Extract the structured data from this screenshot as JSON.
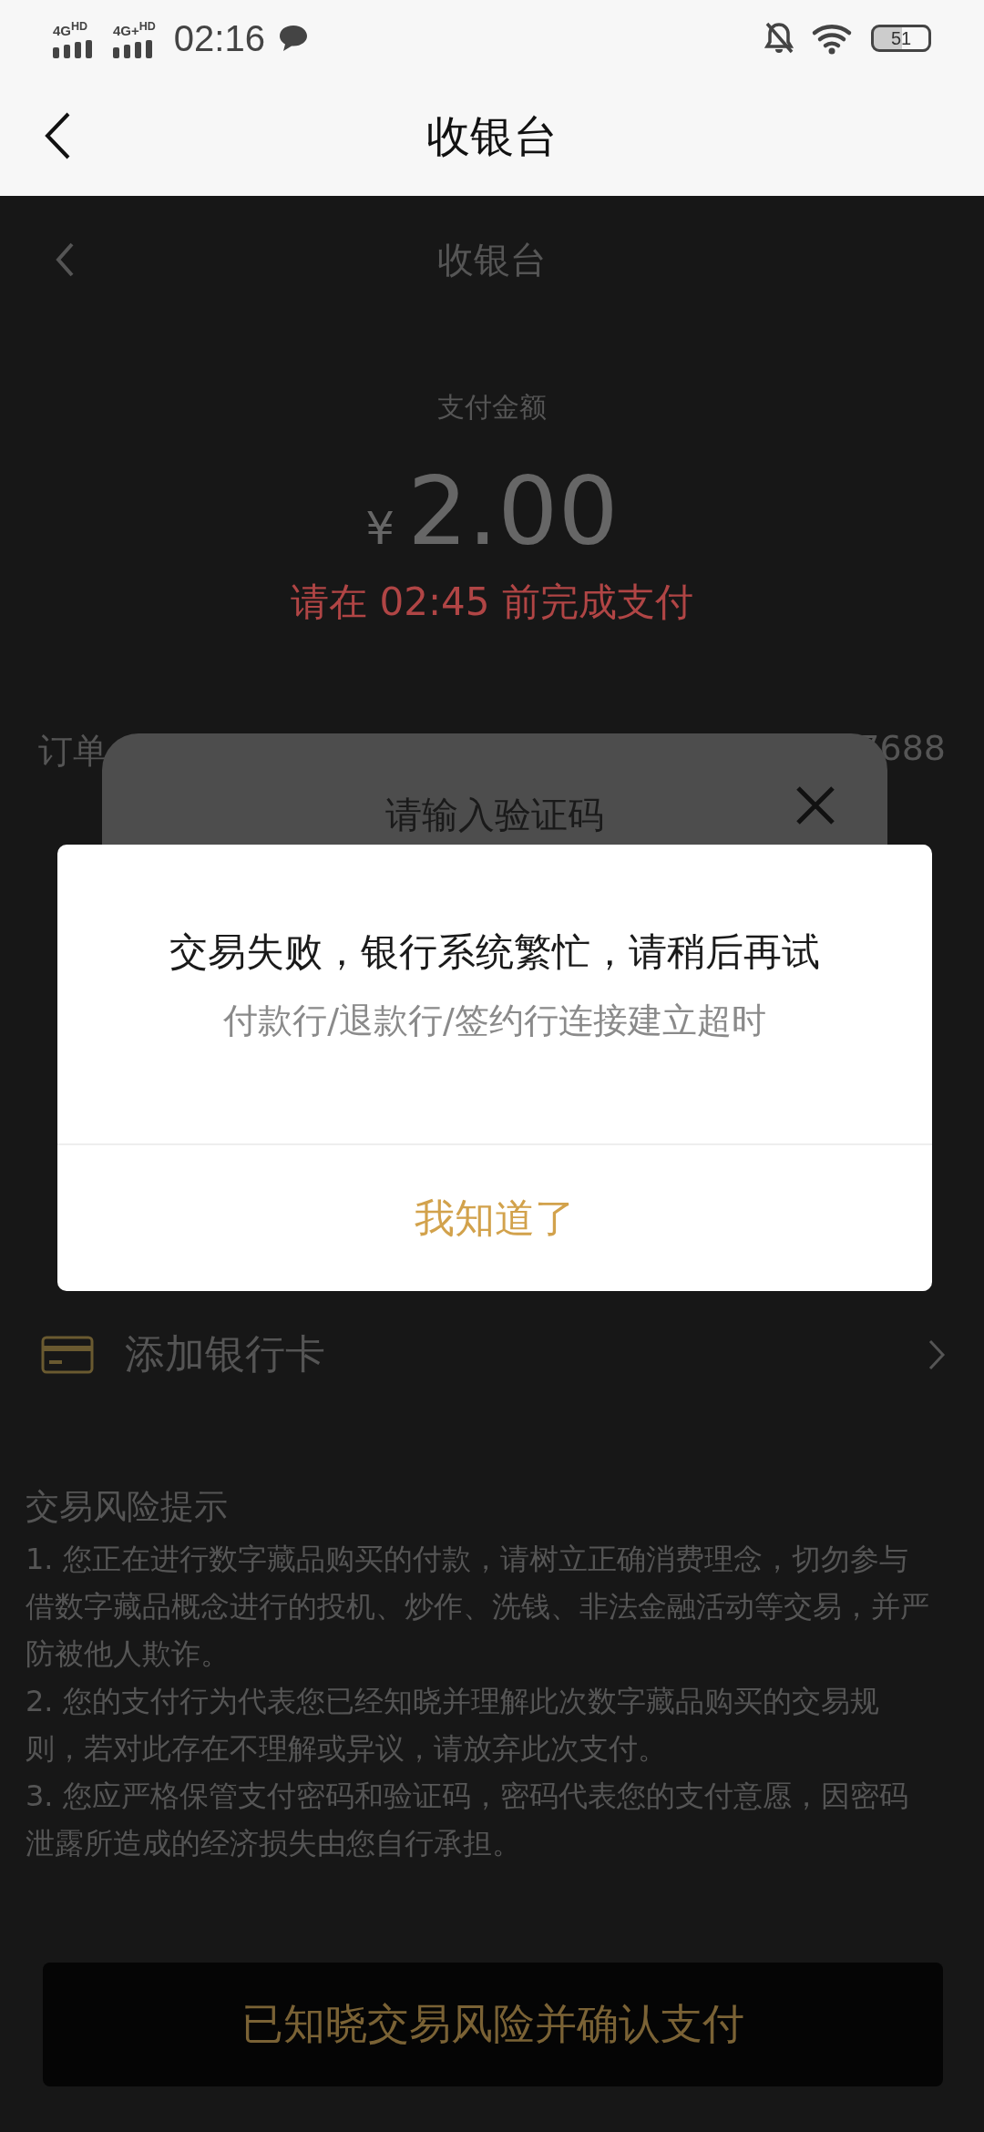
{
  "status_bar": {
    "networks": [
      "4G$^{HD}$",
      "4G+$^{HD}$"
    ],
    "time": "02:16",
    "battery": "51"
  },
  "header": {
    "title": "收银台"
  },
  "page": {
    "title": "收银台",
    "amount_label": "支付金额",
    "currency": "¥",
    "amount": "2.00",
    "deadline": "请在 02:45 前完成支付",
    "order_row": {
      "label": "订单",
      "value": "7688"
    },
    "add_card": {
      "label": "添加银行卡"
    },
    "risk": {
      "title": "交易风险提示",
      "items": [
        "1. 您正在进行数字藏品购买的付款，请树立正确消费理念，切勿参与借数字藏品概念进行的投机、炒作、洗钱、非法金融活动等交易，并严防被他人欺诈。",
        "2. 您的支付行为代表您已经知晓并理解此次数字藏品购买的交易规则，若对此存在不理解或异议，请放弃此次支付。",
        "3. 您应严格保管支付密码和验证码，密码代表您的支付意愿，因密码泄露所造成的经济损失由您自行承担。"
      ]
    },
    "confirm_button": "已知晓交易风险并确认支付"
  },
  "code_sheet": {
    "title": "请输入验证码"
  },
  "alert": {
    "title": "交易失败，银行系统繁忙，请稍后再试",
    "message": "付款行/退款行/签约行连接建立超时",
    "button": "我知道了"
  }
}
